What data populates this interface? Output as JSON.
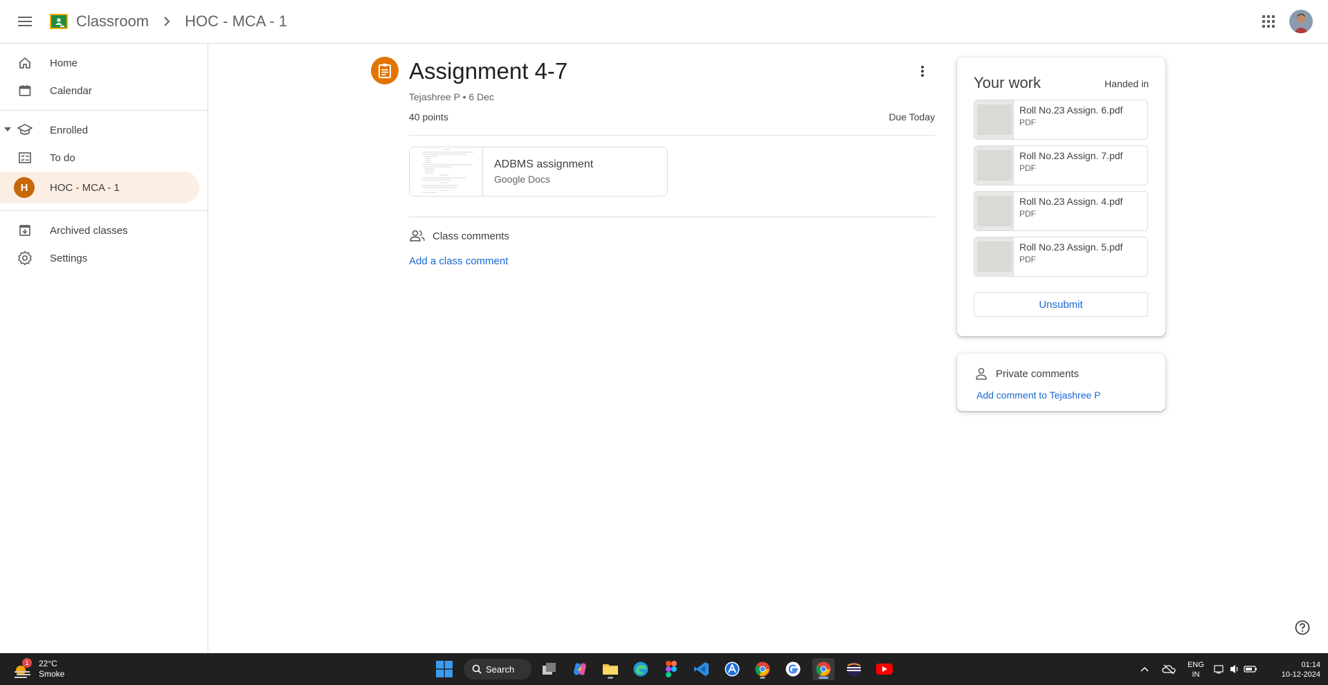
{
  "header": {
    "app_name": "Classroom",
    "class_name": "HOC - MCA - 1"
  },
  "sidebar": {
    "home": "Home",
    "calendar": "Calendar",
    "enrolled": "Enrolled",
    "todo": "To do",
    "class_initial": "H",
    "class_name": "HOC - MCA - 1",
    "archived": "Archived classes",
    "settings": "Settings"
  },
  "assignment": {
    "title": "Assignment 4-7",
    "meta": "Tejashree P • 6 Dec",
    "points": "40 points",
    "due": "Due Today",
    "attachment": {
      "name": "ADBMS assignment",
      "type": "Google Docs"
    },
    "class_comments_label": "Class comments",
    "add_class_comment": "Add a class comment"
  },
  "your_work": {
    "title": "Your work",
    "status": "Handed in",
    "files": [
      {
        "name": "Roll No.23 Assign. 6.pdf",
        "type": "PDF"
      },
      {
        "name": "Roll No.23 Assign. 7.pdf",
        "type": "PDF"
      },
      {
        "name": "Roll No.23 Assign. 4.pdf",
        "type": "PDF"
      },
      {
        "name": "Roll No.23 Assign. 5.pdf",
        "type": "PDF"
      }
    ],
    "unsubmit": "Unsubmit"
  },
  "private_comments": {
    "label": "Private comments",
    "add": "Add comment to Tejashree P"
  },
  "taskbar": {
    "weather_temp": "22°C",
    "weather_desc": "Smoke",
    "weather_badge": "1",
    "search": "Search",
    "lang_1": "ENG",
    "lang_2": "IN",
    "time": "01:14",
    "date": "10-12-2024"
  },
  "colors": {
    "accent_blue": "#1967d2",
    "assignment_orange": "#e37400",
    "class_avatar": "#c7680a",
    "active_nav_bg": "#fdeee3"
  },
  "icons": [
    "menu-icon",
    "classroom-logo-icon",
    "chevron-right-icon",
    "apps-grid-icon",
    "home-icon",
    "calendar-icon",
    "enrolled-icon",
    "todo-icon",
    "archive-icon",
    "settings-icon",
    "assignment-icon",
    "more-vert-icon",
    "people-icon",
    "person-icon",
    "help-icon"
  ]
}
